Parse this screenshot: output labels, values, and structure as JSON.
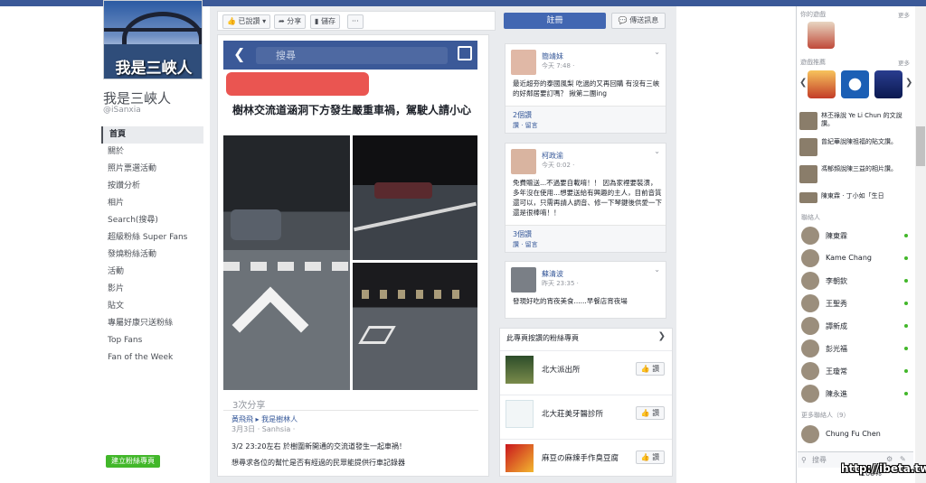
{
  "page": {
    "cover_name": "我是三峽人",
    "title": "我是三峽人",
    "handle": "@iSanxia",
    "create_page": "建立粉絲專頁"
  },
  "nav": [
    {
      "label": "首頁"
    },
    {
      "label": "關於"
    },
    {
      "label": "照片票選活動"
    },
    {
      "label": "按讚分析"
    },
    {
      "label": "相片"
    },
    {
      "label": "Search(搜尋)"
    },
    {
      "label": "超級粉絲 Super Fans"
    },
    {
      "label": "發燒粉絲活動"
    },
    {
      "label": "活動"
    },
    {
      "label": "影片"
    },
    {
      "label": "貼文"
    },
    {
      "label": "專屬好康只送粉絲"
    },
    {
      "label": "Top Fans"
    },
    {
      "label": "Fan of the Week"
    }
  ],
  "actions": {
    "liked": "已說讚",
    "share": "分享",
    "save": "儲存",
    "more": "···",
    "register": "註冊",
    "message": "傳送訊息"
  },
  "post": {
    "search_placeholder": "搜尋",
    "headline": "樹林交流道涵洞下方發生嚴重車禍，駕駛人請小心",
    "shares": "3次分享",
    "poster": "黃飛飛 ▸ 我是樹林人",
    "meta": "3月3日 · Sanhsia · ",
    "text1": "3/2 23:20左右 於樹圍新開通的交流道發生一起車禍！",
    "text2": "想尋求各位的幫忙是否有經過的民眾能提供行車記錄器"
  },
  "visitor_posts": [
    {
      "name": "簡靖妹",
      "time": "今天 7:48 · ",
      "text": "最近超夯的泰國風梨 吃過的又再回購 有沒有三峽的好鄰居要訂嗎？ 揪第二團ing",
      "comments": "2個讚",
      "links": "讚 · 留言"
    },
    {
      "name": "柯政渝",
      "time": "今天 0:02 · ",
      "text": "免費贈送...不過要自載唷！！ 因為家裡要裝潢，多年沒在使用...想要送給有興趣的主人，目前音質還可以，只需再請人調音、修一下琴鍵後供愛一下還是很棒唷！！",
      "comments": "3個讚",
      "links": "讚 · 留言"
    },
    {
      "name": "蘇清波",
      "time": "昨天 23:35 · ",
      "text": "發現好吃的宵夜美食......早餐店宵夜場",
      "comments": "",
      "links": ""
    }
  ],
  "liked_pages": {
    "title": "此專頁按讚的粉絲專頁",
    "items": [
      {
        "name": "北大派出所",
        "like": "讚"
      },
      {
        "name": "北大莊美牙醫診所",
        "like": "讚"
      },
      {
        "name": "麻豆の麻辣手作臭豆腐",
        "like": "讚"
      }
    ]
  },
  "sidebar": {
    "your_games": "你的遊戲",
    "more": "更多",
    "game_suggestions": "遊戲推薦",
    "ticker": [
      {
        "text": "林丕祿說 Ye Li Chun 的文說讚。"
      },
      {
        "text": "曾紀華說陳祖福的貼文讚。"
      },
      {
        "text": "馮郁頻說陳三益的相片讚。"
      },
      {
        "text": "陳東霖 · 丁小如「生日"
      }
    ],
    "contacts_label": "聯絡人",
    "contacts": [
      {
        "name": "陳東霖"
      },
      {
        "name": "Kame Chang"
      },
      {
        "name": "李朝欽"
      },
      {
        "name": "王聖秀"
      },
      {
        "name": "譚新成"
      },
      {
        "name": "彭光福"
      },
      {
        "name": "王瓊常"
      },
      {
        "name": "陳永進"
      }
    ],
    "more_contacts": "更多聯絡人（9）",
    "extra_contact": "Chung Fu Chen",
    "search": "搜尋"
  },
  "watermark": "http://ibeta.tw",
  "zoom": "100%"
}
